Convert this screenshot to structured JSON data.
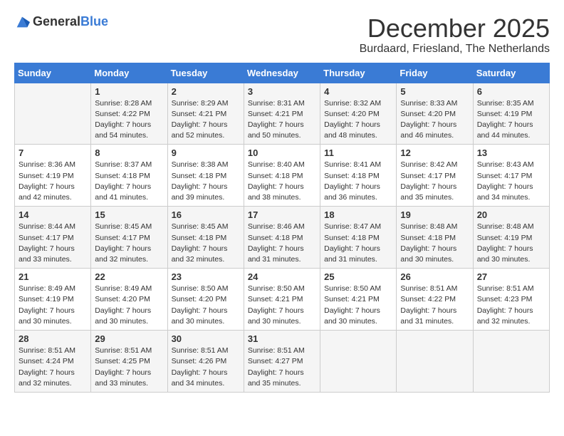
{
  "header": {
    "logo_general": "General",
    "logo_blue": "Blue",
    "month": "December 2025",
    "location": "Burdaard, Friesland, The Netherlands"
  },
  "days_of_week": [
    "Sunday",
    "Monday",
    "Tuesday",
    "Wednesday",
    "Thursday",
    "Friday",
    "Saturday"
  ],
  "weeks": [
    [
      {
        "day": "",
        "info": ""
      },
      {
        "day": "1",
        "info": "Sunrise: 8:28 AM\nSunset: 4:22 PM\nDaylight: 7 hours\nand 54 minutes."
      },
      {
        "day": "2",
        "info": "Sunrise: 8:29 AM\nSunset: 4:21 PM\nDaylight: 7 hours\nand 52 minutes."
      },
      {
        "day": "3",
        "info": "Sunrise: 8:31 AM\nSunset: 4:21 PM\nDaylight: 7 hours\nand 50 minutes."
      },
      {
        "day": "4",
        "info": "Sunrise: 8:32 AM\nSunset: 4:20 PM\nDaylight: 7 hours\nand 48 minutes."
      },
      {
        "day": "5",
        "info": "Sunrise: 8:33 AM\nSunset: 4:20 PM\nDaylight: 7 hours\nand 46 minutes."
      },
      {
        "day": "6",
        "info": "Sunrise: 8:35 AM\nSunset: 4:19 PM\nDaylight: 7 hours\nand 44 minutes."
      }
    ],
    [
      {
        "day": "7",
        "info": "Sunrise: 8:36 AM\nSunset: 4:19 PM\nDaylight: 7 hours\nand 42 minutes."
      },
      {
        "day": "8",
        "info": "Sunrise: 8:37 AM\nSunset: 4:18 PM\nDaylight: 7 hours\nand 41 minutes."
      },
      {
        "day": "9",
        "info": "Sunrise: 8:38 AM\nSunset: 4:18 PM\nDaylight: 7 hours\nand 39 minutes."
      },
      {
        "day": "10",
        "info": "Sunrise: 8:40 AM\nSunset: 4:18 PM\nDaylight: 7 hours\nand 38 minutes."
      },
      {
        "day": "11",
        "info": "Sunrise: 8:41 AM\nSunset: 4:18 PM\nDaylight: 7 hours\nand 36 minutes."
      },
      {
        "day": "12",
        "info": "Sunrise: 8:42 AM\nSunset: 4:17 PM\nDaylight: 7 hours\nand 35 minutes."
      },
      {
        "day": "13",
        "info": "Sunrise: 8:43 AM\nSunset: 4:17 PM\nDaylight: 7 hours\nand 34 minutes."
      }
    ],
    [
      {
        "day": "14",
        "info": "Sunrise: 8:44 AM\nSunset: 4:17 PM\nDaylight: 7 hours\nand 33 minutes."
      },
      {
        "day": "15",
        "info": "Sunrise: 8:45 AM\nSunset: 4:17 PM\nDaylight: 7 hours\nand 32 minutes."
      },
      {
        "day": "16",
        "info": "Sunrise: 8:45 AM\nSunset: 4:18 PM\nDaylight: 7 hours\nand 32 minutes."
      },
      {
        "day": "17",
        "info": "Sunrise: 8:46 AM\nSunset: 4:18 PM\nDaylight: 7 hours\nand 31 minutes."
      },
      {
        "day": "18",
        "info": "Sunrise: 8:47 AM\nSunset: 4:18 PM\nDaylight: 7 hours\nand 31 minutes."
      },
      {
        "day": "19",
        "info": "Sunrise: 8:48 AM\nSunset: 4:18 PM\nDaylight: 7 hours\nand 30 minutes."
      },
      {
        "day": "20",
        "info": "Sunrise: 8:48 AM\nSunset: 4:19 PM\nDaylight: 7 hours\nand 30 minutes."
      }
    ],
    [
      {
        "day": "21",
        "info": "Sunrise: 8:49 AM\nSunset: 4:19 PM\nDaylight: 7 hours\nand 30 minutes."
      },
      {
        "day": "22",
        "info": "Sunrise: 8:49 AM\nSunset: 4:20 PM\nDaylight: 7 hours\nand 30 minutes."
      },
      {
        "day": "23",
        "info": "Sunrise: 8:50 AM\nSunset: 4:20 PM\nDaylight: 7 hours\nand 30 minutes."
      },
      {
        "day": "24",
        "info": "Sunrise: 8:50 AM\nSunset: 4:21 PM\nDaylight: 7 hours\nand 30 minutes."
      },
      {
        "day": "25",
        "info": "Sunrise: 8:50 AM\nSunset: 4:21 PM\nDaylight: 7 hours\nand 30 minutes."
      },
      {
        "day": "26",
        "info": "Sunrise: 8:51 AM\nSunset: 4:22 PM\nDaylight: 7 hours\nand 31 minutes."
      },
      {
        "day": "27",
        "info": "Sunrise: 8:51 AM\nSunset: 4:23 PM\nDaylight: 7 hours\nand 32 minutes."
      }
    ],
    [
      {
        "day": "28",
        "info": "Sunrise: 8:51 AM\nSunset: 4:24 PM\nDaylight: 7 hours\nand 32 minutes."
      },
      {
        "day": "29",
        "info": "Sunrise: 8:51 AM\nSunset: 4:25 PM\nDaylight: 7 hours\nand 33 minutes."
      },
      {
        "day": "30",
        "info": "Sunrise: 8:51 AM\nSunset: 4:26 PM\nDaylight: 7 hours\nand 34 minutes."
      },
      {
        "day": "31",
        "info": "Sunrise: 8:51 AM\nSunset: 4:27 PM\nDaylight: 7 hours\nand 35 minutes."
      },
      {
        "day": "",
        "info": ""
      },
      {
        "day": "",
        "info": ""
      },
      {
        "day": "",
        "info": ""
      }
    ]
  ]
}
